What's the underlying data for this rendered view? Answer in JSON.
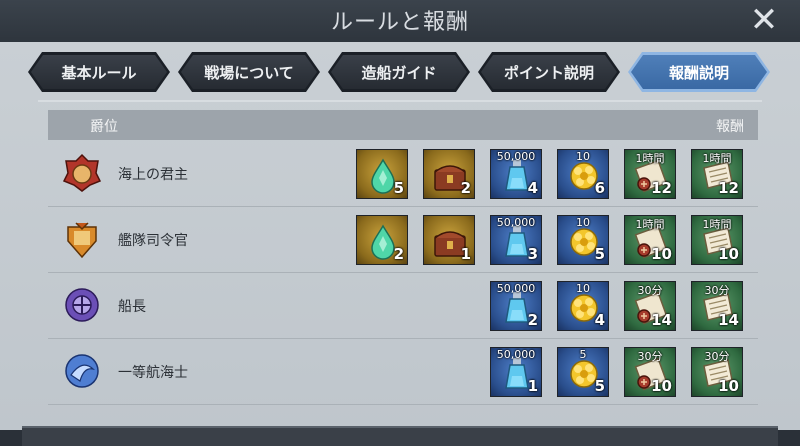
{
  "header": {
    "title": "ルールと報酬"
  },
  "tabs": [
    {
      "label": "基本ルール"
    },
    {
      "label": "戦場について"
    },
    {
      "label": "造船ガイド"
    },
    {
      "label": "ポイント説明"
    },
    {
      "label": "報酬説明",
      "active": true
    }
  ],
  "table": {
    "rank_header": "爵位",
    "reward_header": "報酬"
  },
  "rows": [
    {
      "rank": "海上の君主",
      "items": [
        {
          "icon": "gem-icon",
          "frame": "gold",
          "qty": "5"
        },
        {
          "icon": "chest-icon",
          "frame": "gold",
          "qty": "2"
        },
        {
          "icon": "potion-icon",
          "frame": "blue",
          "top": "50,000",
          "qty": "4"
        },
        {
          "icon": "flower-icon",
          "frame": "blue",
          "top": "10",
          "qty": "6"
        },
        {
          "icon": "scroll-icon",
          "frame": "green",
          "top": "1時間",
          "qty": "12"
        },
        {
          "icon": "paper-icon",
          "frame": "green",
          "top": "1時間",
          "qty": "12"
        }
      ]
    },
    {
      "rank": "艦隊司令官",
      "items": [
        {
          "icon": "gem-icon",
          "frame": "gold",
          "qty": "2"
        },
        {
          "icon": "chest-icon",
          "frame": "gold",
          "qty": "1"
        },
        {
          "icon": "potion-icon",
          "frame": "blue",
          "top": "50,000",
          "qty": "3"
        },
        {
          "icon": "flower-icon",
          "frame": "blue",
          "top": "10",
          "qty": "5"
        },
        {
          "icon": "scroll-icon",
          "frame": "green",
          "top": "1時間",
          "qty": "10"
        },
        {
          "icon": "paper-icon",
          "frame": "green",
          "top": "1時間",
          "qty": "10"
        }
      ]
    },
    {
      "rank": "船長",
      "items": [
        {
          "icon": "potion-icon",
          "frame": "blue",
          "top": "50,000",
          "qty": "2"
        },
        {
          "icon": "flower-icon",
          "frame": "blue",
          "top": "10",
          "qty": "4"
        },
        {
          "icon": "scroll-icon",
          "frame": "green",
          "top": "30分",
          "qty": "14"
        },
        {
          "icon": "paper-icon",
          "frame": "green",
          "top": "30分",
          "qty": "14"
        }
      ]
    },
    {
      "rank": "一等航海士",
      "items": [
        {
          "icon": "potion-icon",
          "frame": "blue",
          "top": "50,000",
          "qty": "1"
        },
        {
          "icon": "flower-icon",
          "frame": "blue",
          "top": "5",
          "qty": "5"
        },
        {
          "icon": "scroll-icon",
          "frame": "green",
          "top": "30分",
          "qty": "10"
        },
        {
          "icon": "paper-icon",
          "frame": "green",
          "top": "30分",
          "qty": "10"
        }
      ]
    }
  ]
}
